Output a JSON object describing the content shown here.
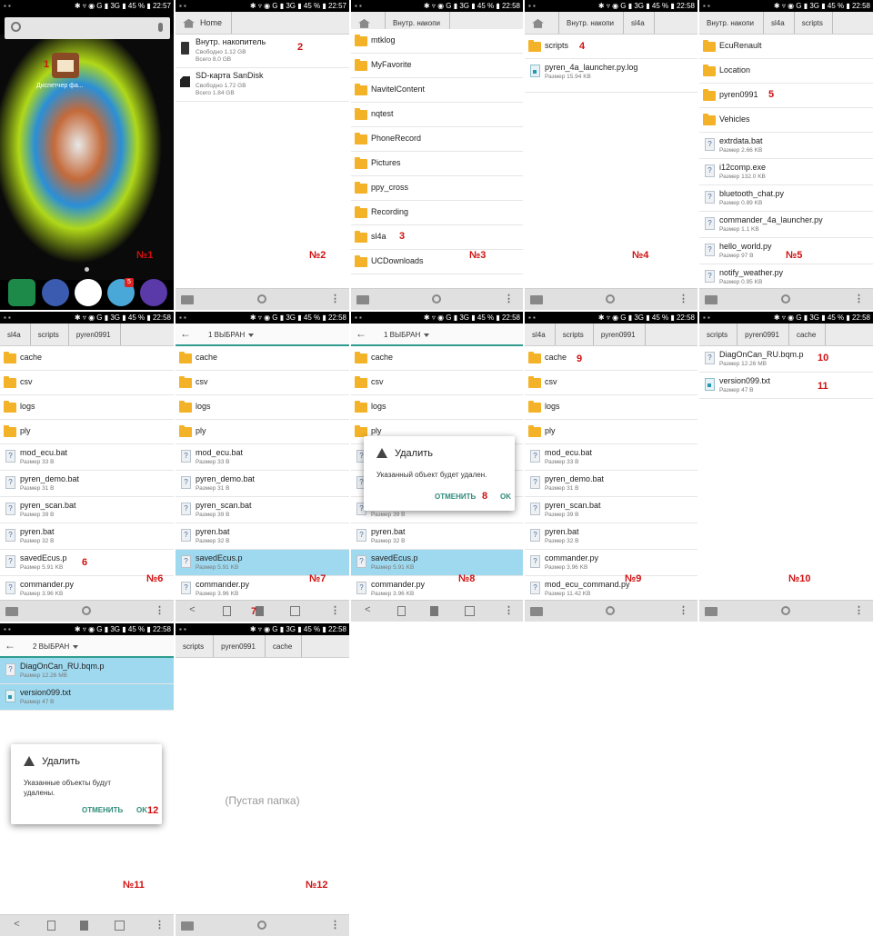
{
  "status": {
    "time_2257": "22:57",
    "time_2258": "22:58",
    "indicators": "✱ ▿ ◉ G ▮ 3G ▮ 45 % ▮"
  },
  "panel_labels": [
    "№1",
    "№2",
    "№3",
    "№4",
    "№5",
    "№6",
    "№7",
    "№8",
    "№9",
    "№10",
    "№11",
    "№12"
  ],
  "step_numbers": [
    "1",
    "2",
    "3",
    "4",
    "5",
    "6",
    "7",
    "8",
    "9",
    "10",
    "11",
    "12"
  ],
  "p1": {
    "app_label": "Диспетчер фа...",
    "badge": "5"
  },
  "p2": {
    "crumb": "Home",
    "items": [
      {
        "name": "Внутр. накопитель",
        "free": "Свободно 1.12 GB",
        "total": "Всего 8.0 GB"
      },
      {
        "name": "SD-карта SanDisk",
        "free": "Свободно 1.72 GB",
        "total": "Всего 1.84 GB"
      }
    ]
  },
  "p3": {
    "crumb": "Внутр. накопи",
    "items": [
      "mtklog",
      "MyFavorite",
      "NavitelContent",
      "nqtest",
      "PhoneRecord",
      "Pictures",
      "ppy_cross",
      "Recording",
      "sl4a",
      "UCDownloads"
    ]
  },
  "p4": {
    "crumbs": [
      "Внутр. накопи",
      "sl4a"
    ],
    "folder": "scripts",
    "file": {
      "name": "pyren_4a_launcher.py.log",
      "meta": "Размер 15.94 KB"
    }
  },
  "p5": {
    "crumbs": [
      "Внутр. накопи",
      "sl4a",
      "scripts"
    ],
    "folders": [
      "EcuRenault",
      "Location",
      "pyren0991",
      "Vehicles"
    ],
    "files": [
      {
        "name": "extrdata.bat",
        "meta": "Размер 2.66 KB"
      },
      {
        "name": "i12comp.exe",
        "meta": "Размер 132.0 KB"
      },
      {
        "name": "bluetooth_chat.py",
        "meta": "Размер 0.89 KB"
      },
      {
        "name": "commander_4a_launcher.py",
        "meta": "Размер 1.1 KB"
      },
      {
        "name": "hello_world.py",
        "meta": "Размер 97 B"
      },
      {
        "name": "notify_weather.py",
        "meta": "Размер 0.95 KB"
      }
    ]
  },
  "p6": {
    "crumbs": [
      "sl4a",
      "scripts",
      "pyren0991"
    ],
    "folders": [
      "cache",
      "csv",
      "logs",
      "ply"
    ],
    "files": [
      {
        "name": "mod_ecu.bat",
        "meta": "Размер 33 B"
      },
      {
        "name": "pyren_demo.bat",
        "meta": "Размер 31 B"
      },
      {
        "name": "pyren_scan.bat",
        "meta": "Размер 39 B"
      },
      {
        "name": "pyren.bat",
        "meta": "Размер 32 B"
      },
      {
        "name": "savedEcus.p",
        "meta": "Размер 5.91 KB"
      },
      {
        "name": "commander.py",
        "meta": "Размер 3.96 KB"
      }
    ]
  },
  "p7": {
    "selected": "1 ВЫБРАН"
  },
  "p8": {
    "selected": "1 ВЫБРАН",
    "dialog_title": "Удалить",
    "dialog_msg": "Указанный объект будет удален.",
    "cancel": "ОТМЕНИТЬ",
    "ok": "OK"
  },
  "p9": {
    "crumbs": [
      "sl4a",
      "scripts",
      "pyren0991"
    ],
    "files": [
      {
        "name": "mod_ecu.bat",
        "meta": "Размер 33 B"
      },
      {
        "name": "pyren_demo.bat",
        "meta": "Размер 31 B"
      },
      {
        "name": "pyren_scan.bat",
        "meta": "Размер 39 B"
      },
      {
        "name": "pyren.bat",
        "meta": "Размер 32 B"
      },
      {
        "name": "commander.py",
        "meta": "Размер 3.96 KB"
      },
      {
        "name": "mod_ecu_command.py",
        "meta": "Размер 11.42 KB"
      }
    ]
  },
  "p10": {
    "crumbs": [
      "scripts",
      "pyren0991",
      "cache"
    ],
    "files": [
      {
        "name": "DiagOnCan_RU.bqm.p",
        "meta": "Размер 12.26 MB"
      },
      {
        "name": "version099.txt",
        "meta": "Размер 47 B"
      }
    ]
  },
  "p11": {
    "selected": "2 ВЫБРАН",
    "dialog_title": "Удалить",
    "dialog_msg1": "Указанные объекты будут",
    "dialog_msg2": "удалены.",
    "cancel": "ОТМЕНИТЬ",
    "ok": "OK"
  },
  "p12": {
    "crumbs": [
      "scripts",
      "pyren0991",
      "cache"
    ],
    "empty": "(Пустая папка)"
  }
}
